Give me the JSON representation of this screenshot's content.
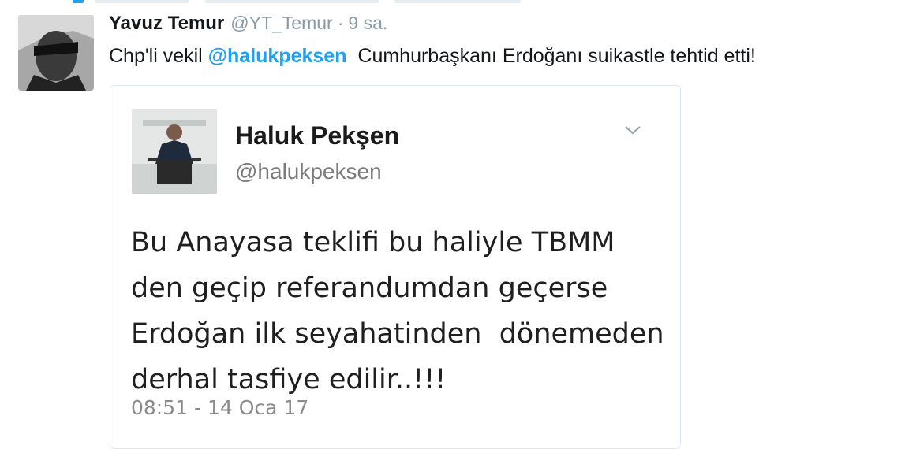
{
  "tweet": {
    "display_name": "Yavuz Temur",
    "screen_name": "@YT_Temur",
    "separator": "·",
    "timestamp": "9 sa.",
    "text_before": "Chp'li vekil ",
    "mention": "@halukpeksen",
    "text_after": "  Cumhurbaşkanı Erdoğanı suikastle tehtid etti!"
  },
  "embedded": {
    "display_name": "Haluk Pekşen",
    "screen_name": "@halukpeksen",
    "body_lines": [
      "Bu Anayasa teklifi bu haliyle TBMM",
      "den geçip referandumdan geçerse",
      "Erdoğan ilk seyahatinden  dönemeden",
      "derhal tasfiye edilir..!!!"
    ],
    "timestamp": "08:51 - 14 Oca 17"
  },
  "icons": {
    "menu": "chevron-down-icon",
    "accent_color": "#1da1f2",
    "meta_color": "#8899a6"
  }
}
